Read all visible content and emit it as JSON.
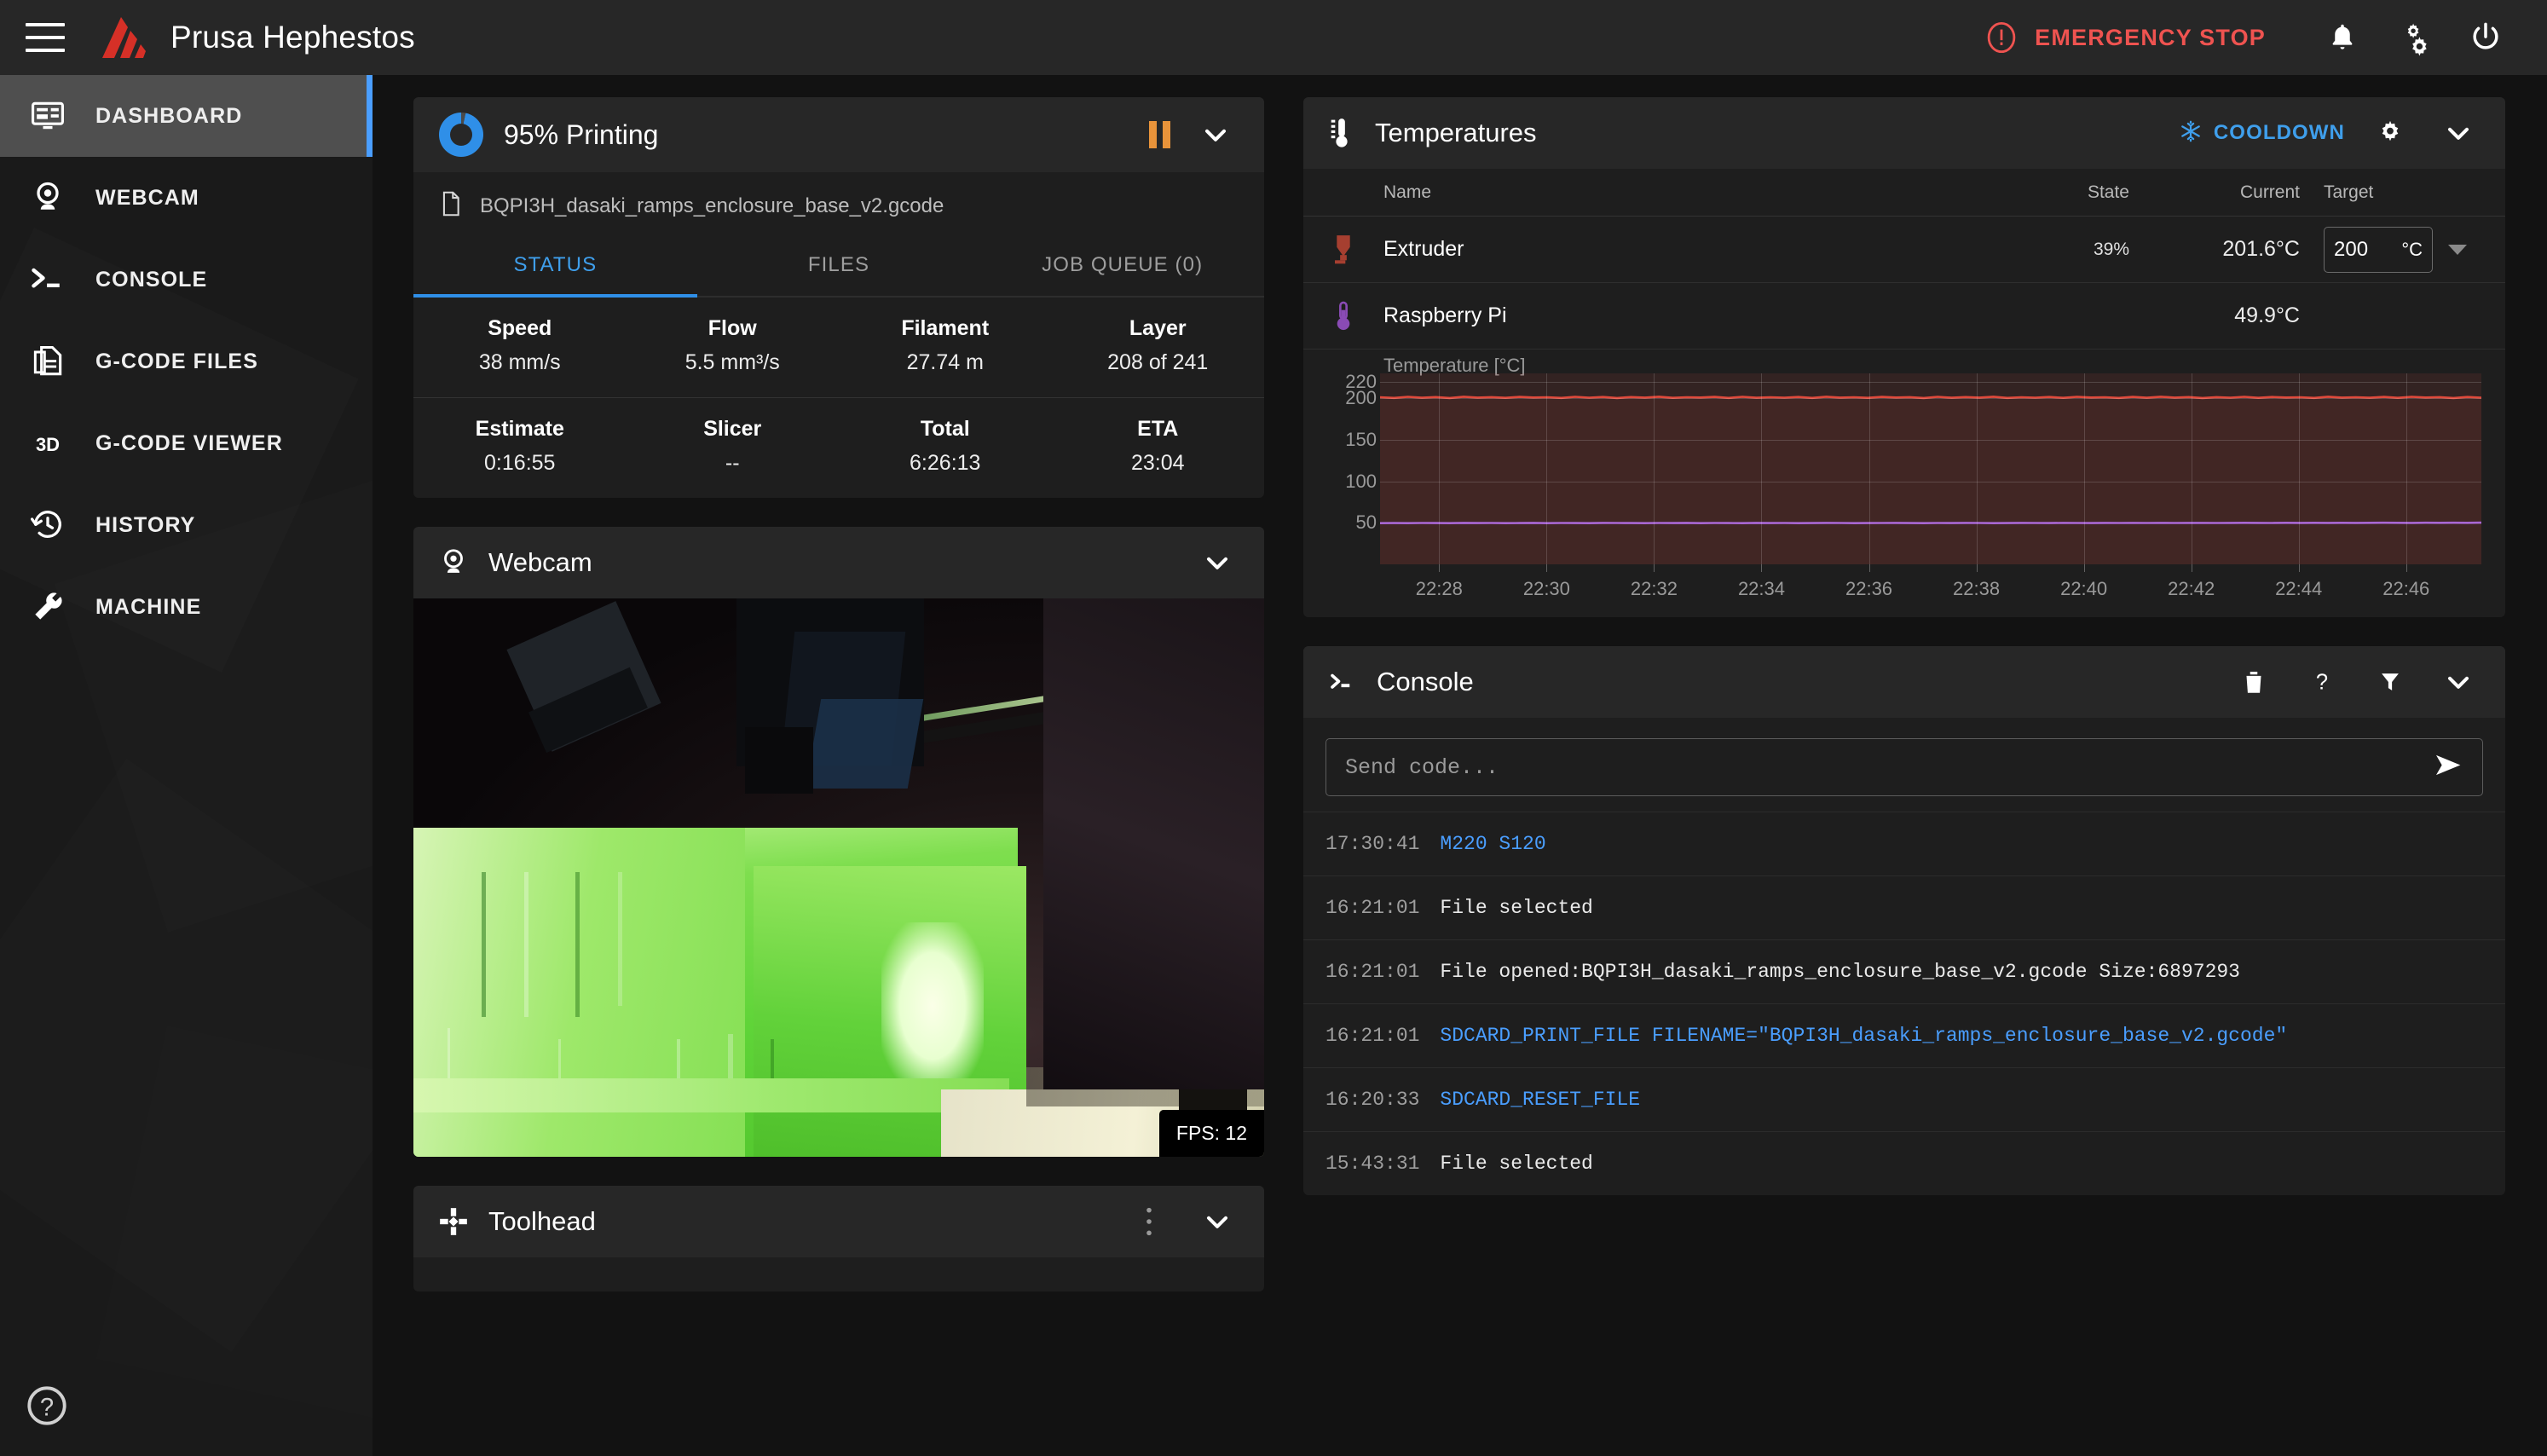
{
  "header": {
    "title": "Prusa Hephestos",
    "menu_icon": "hamburger-icon",
    "logo_icon": "mainsail-logo-icon",
    "emergency_stop": "EMERGENCY STOP",
    "icons": [
      "bell-icon",
      "gears-icon",
      "power-icon"
    ]
  },
  "sidebar": {
    "items": [
      {
        "label": "DASHBOARD",
        "icon": "dashboard-icon",
        "active": true
      },
      {
        "label": "WEBCAM",
        "icon": "webcam-icon",
        "active": false
      },
      {
        "label": "CONSOLE",
        "icon": "console-prompt-icon",
        "active": false
      },
      {
        "label": "G-CODE FILES",
        "icon": "file-copy-icon",
        "active": false
      },
      {
        "label": "G-CODE VIEWER",
        "icon": "3d-icon",
        "active": false
      },
      {
        "label": "HISTORY",
        "icon": "history-clock-icon",
        "active": false
      },
      {
        "label": "MACHINE",
        "icon": "wrench-icon",
        "active": false
      }
    ],
    "help_icon": "help-circle-icon"
  },
  "status_card": {
    "progress_percent": 95,
    "title": "95% Printing",
    "pause_icon": "pause-icon",
    "collapse_icon": "chevron-down-icon",
    "file_icon": "file-icon",
    "filename": "BQPI3H_dasaki_ramps_enclosure_base_v2.gcode",
    "tabs": [
      {
        "label": "STATUS",
        "selected": true
      },
      {
        "label": "FILES",
        "selected": false
      },
      {
        "label": "JOB QUEUE (0)",
        "selected": false
      }
    ],
    "stats": [
      {
        "key": "Speed",
        "value": "38 mm/s"
      },
      {
        "key": "Flow",
        "value": "5.5 mm³/s"
      },
      {
        "key": "Filament",
        "value": "27.74 m"
      },
      {
        "key": "Layer",
        "value": "208 of 241"
      },
      {
        "key": "Estimate",
        "value": "0:16:55"
      },
      {
        "key": "Slicer",
        "value": "--"
      },
      {
        "key": "Total",
        "value": "6:26:13"
      },
      {
        "key": "ETA",
        "value": "23:04"
      }
    ]
  },
  "webcam_card": {
    "title": "Webcam",
    "icon": "webcam-icon",
    "collapse_icon": "chevron-down-icon",
    "fps_label": "FPS: 12"
  },
  "toolhead_card": {
    "title": "Toolhead",
    "icon": "toolhead-crosshair-icon",
    "menu_icon": "dots-vertical-icon",
    "collapse_icon": "chevron-down-icon"
  },
  "temperatures_card": {
    "title": "Temperatures",
    "icon": "thermometer-icon",
    "cooldown_label": "COOLDOWN",
    "cooldown_icon": "snowflake-icon",
    "settings_icon": "gear-icon",
    "collapse_icon": "chevron-down-icon",
    "columns": [
      "Name",
      "State",
      "Current",
      "Target"
    ],
    "rows": [
      {
        "icon": "extruder-nozzle-icon",
        "icon_color": "#a63f30",
        "name": "Extruder",
        "state": "39%",
        "current": "201.6°C",
        "target_value": "200",
        "target_unit": "°C",
        "has_target": true
      },
      {
        "icon": "thermometer-small-icon",
        "icon_color": "#8a4bb5",
        "name": "Raspberry Pi",
        "state": "",
        "current": "49.9°C",
        "target_value": "",
        "target_unit": "",
        "has_target": false
      }
    ]
  },
  "console_card": {
    "title": "Console",
    "icon": "console-prompt-icon",
    "actions": [
      "trash-icon",
      "help-icon",
      "filter-icon",
      "chevron-down-icon"
    ],
    "input_placeholder": "Send code...",
    "send_icon": "send-arrow-icon",
    "log": [
      {
        "time": "17:30:41",
        "message": "M220 S120",
        "type": "command"
      },
      {
        "time": "16:21:01",
        "message": "File selected",
        "type": "response"
      },
      {
        "time": "16:21:01",
        "message": "File opened:BQPI3H_dasaki_ramps_enclosure_base_v2.gcode Size:6897293",
        "type": "response"
      },
      {
        "time": "16:21:01",
        "message": "SDCARD_PRINT_FILE FILENAME=\"BQPI3H_dasaki_ramps_enclosure_base_v2.gcode\"",
        "type": "command"
      },
      {
        "time": "16:20:33",
        "message": "SDCARD_RESET_FILE",
        "type": "command"
      },
      {
        "time": "15:43:31",
        "message": "File selected",
        "type": "response"
      }
    ]
  },
  "colors": {
    "accent_blue": "#2f8fe8",
    "danger_red": "#ef5350",
    "warning_orange": "#e8933a",
    "extruder_line": "#e04a3c",
    "rpi_line": "#a35cd1",
    "panel_bg": "#1e1e1e",
    "header_bg": "#272727",
    "page_bg": "#121212"
  },
  "chart_data": {
    "type": "line",
    "title": "Temperature [°C]",
    "xlabel": "",
    "ylabel": "Temperature [°C]",
    "ylim": [
      0,
      230
    ],
    "yticks": [
      220,
      200,
      150,
      100,
      50
    ],
    "xticks": [
      "22:28",
      "22:30",
      "22:32",
      "22:34",
      "22:36",
      "22:38",
      "22:40",
      "22:42",
      "22:44",
      "22:46"
    ],
    "grid": true,
    "legend": "none",
    "series": [
      {
        "name": "Extruder",
        "color": "#e04a3c",
        "fill": true,
        "values": [
          201.2,
          200.4,
          201.8,
          200.6,
          201.5,
          200.3,
          201.9,
          200.8,
          201.4,
          200.5,
          201.7,
          200.9,
          201.3,
          200.4,
          201.8,
          200.7,
          201.6,
          200.3,
          201.5,
          200.8,
          201.9,
          200.5,
          201.2,
          200.9,
          201.7,
          200.4,
          201.8,
          200.6,
          201.3,
          200.7,
          201.6,
          200.4,
          201.9,
          200.8,
          201.2,
          200.5,
          201.7,
          200.9,
          201.4,
          200.3,
          201.8,
          200.6,
          201.5,
          200.8,
          201.9,
          200.4,
          201.3,
          200.7,
          201.6,
          200.5,
          201.8,
          200.9,
          201.2,
          200.4,
          201.7,
          200.6,
          201.9,
          200.8,
          201.5,
          200.3,
          201.4,
          200.7,
          201.8,
          200.5,
          201.6,
          200.9,
          201.2,
          200.4,
          201.9,
          200.8,
          201.3,
          200.6,
          201.7,
          200.5,
          201.8,
          200.9,
          201.4,
          200.3,
          201.6,
          200.7
        ]
      },
      {
        "name": "Raspberry Pi",
        "color": "#a35cd1",
        "fill": false,
        "values": [
          49.6,
          49.7,
          49.6,
          49.8,
          49.7,
          49.6,
          49.9,
          49.7,
          49.8,
          49.6,
          49.7,
          49.9,
          49.6,
          49.8,
          49.7,
          49.6,
          49.9,
          49.8,
          49.7,
          49.6,
          49.8,
          49.7,
          49.9,
          49.6,
          49.8,
          49.7,
          49.6,
          49.9,
          49.7,
          49.8,
          49.6,
          49.7,
          49.9,
          49.8,
          49.6,
          49.7,
          49.8,
          49.9,
          49.7,
          49.6,
          49.8,
          49.7,
          49.9,
          49.8,
          49.6,
          49.7,
          49.9,
          49.8,
          49.7,
          49.9,
          49.8,
          49.7,
          49.9,
          49.8,
          49.9,
          49.8,
          49.9,
          49.8,
          49.9,
          49.9,
          49.8,
          49.9,
          50.0,
          49.9,
          49.8,
          50.0,
          49.9,
          50.0,
          49.9,
          50.0,
          49.9,
          50.0,
          50.1,
          50.0,
          49.9,
          50.1,
          50.0,
          50.1,
          50.0,
          50.2
        ]
      }
    ]
  }
}
